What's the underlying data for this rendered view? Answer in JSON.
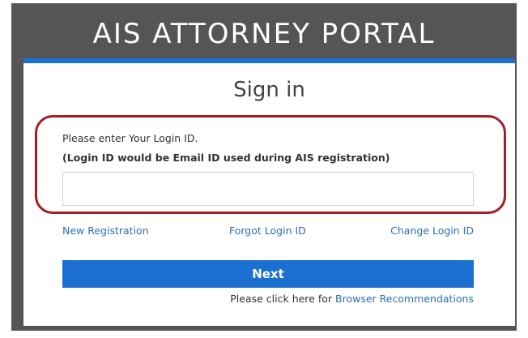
{
  "portal": {
    "title": "AIS ATTORNEY PORTAL"
  },
  "signin": {
    "title": "Sign in",
    "prompt": "Please enter Your Login ID.",
    "note": "(Login ID would be Email ID used during AIS registration)",
    "login_input": {
      "value": "",
      "placeholder": ""
    },
    "links": {
      "new_registration": "New Registration",
      "forgot_login_id": "Forgot Login ID",
      "change_login_id": "Change Login ID"
    },
    "next_label": "Next",
    "browser_note_prefix": "Please click here for",
    "browser_note_link": "Browser Recommendations"
  },
  "colors": {
    "accent": "#1a6fd1",
    "highlight": "#a31f24",
    "link": "#2e6fba",
    "header_bg": "#555555"
  }
}
